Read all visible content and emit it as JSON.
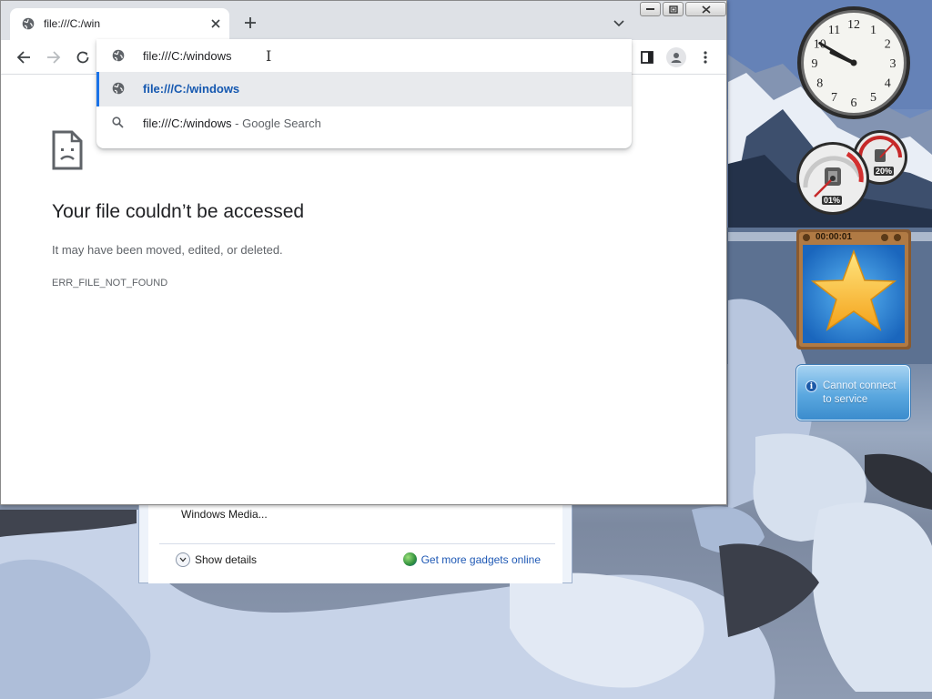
{
  "colors": {
    "accent": "#1a73e8",
    "tab_strip": "#dee1e6",
    "selected_suggestion": "#e8eaed",
    "link": "#1f59b5"
  },
  "browser": {
    "tab": {
      "title": "file:///C:/win",
      "favicon": "globe-icon"
    },
    "omnibox": {
      "value": "file:///C:/windows",
      "suggestions": [
        {
          "icon": "globe-icon",
          "text": "file:///C:/windows",
          "suffix": ""
        },
        {
          "icon": "search-icon",
          "text": "file:///C:/windows",
          "suffix": " - Google Search"
        }
      ]
    },
    "error": {
      "icon": "sad-document-icon",
      "title": "Your file couldn’t be accessed",
      "message": "It may have been moved, edited, or deleted.",
      "code": "ERR_FILE_NOT_FOUND"
    }
  },
  "gadget_gallery": {
    "item_label": "Windows Media...",
    "show_details": "Show details",
    "get_more": "Get more gadgets online"
  },
  "gadgets": {
    "clock": {
      "numbers": [
        "12",
        "1",
        "2",
        "3",
        "4",
        "5",
        "6",
        "7",
        "8",
        "9",
        "10",
        "11"
      ],
      "hours": 9,
      "minutes": 50
    },
    "cpu_meter": {
      "cpu": "01%",
      "memory": "20%"
    },
    "slideshow": {
      "time": "00:00:01"
    },
    "weather": {
      "line1": "Cannot connect",
      "line2": "to service"
    }
  }
}
